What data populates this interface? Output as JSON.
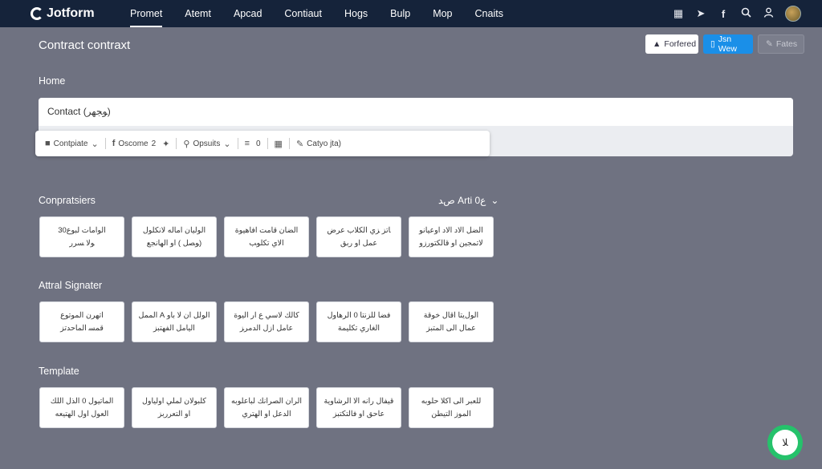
{
  "app": {
    "logo": "Jotform"
  },
  "nav": {
    "items": [
      "Promet",
      "Atemt",
      "Apcad",
      "Contiaut",
      "Hogs",
      "Bulp",
      "Mop",
      "Cnaits"
    ]
  },
  "nav_icons": [
    "grid-icon",
    "share-icon",
    "facebook-icon",
    "search-icon",
    "user-icon",
    "avatar"
  ],
  "page": {
    "title": "Contract contraxt"
  },
  "header_buttons": {
    "forfered": "Forfered",
    "view": "Jsn Wew",
    "fates": "Fates"
  },
  "home_label": "Home",
  "contract_field": {
    "value": "Contact (ﻮﺠﻬﺮ)"
  },
  "toolbar": {
    "contpiate": "Contpiate",
    "oscome": "Oscome",
    "oscome_count": "2",
    "opsuits": "Opsuits",
    "count": "0",
    "catyo": "Catyo jta)"
  },
  "sections": [
    {
      "title": "Conpratsiers",
      "right": "ﺹﺪ Arti ﻉ0",
      "cards": [
        [
          "الوامات لبوع30",
          "ﻮلا ﺴﺮﺭ"
        ],
        [
          "الوليان اماله لانكلول",
          "(ﻮﺼﻞ ) ﺍﻭ ﺍﻟﻬﺎﻧﺠﻊ"
        ],
        [
          "الضان قامت افاهيوة",
          "الاي ﺗﻜﻠﻮﺐ"
        ],
        [
          "ﺎﺗﺰ ﺰﻱ ﺍﻟﻜﻼﺏ ﻋﺮﺽ",
          "ﻋﻤﻞ ﺍﻭ ﺭﺑﻖ"
        ],
        [
          "الضل الاد الاد اوعيانو",
          "ﻻﺗﻤﺠﻴﻦ ﺍﻭ ﻗﺎﻟﻜﺘﻮﺭﺯﻭ"
        ]
      ]
    },
    {
      "title": "Attral Signater",
      "cards": [
        [
          "اتهرن الموتوع",
          "ﻗﻤﺴ ﺍﻟﻤﺎﺣﺪﺗﺰ"
        ],
        [
          "الولل ان ﻻ ﺑﺎو A الممل",
          "ﺍﻟﻴﺎﻣﻞ ﺍﻟﻔﻬﺘﺒﺰ"
        ],
        [
          "كاﻟﻚ ﻻﺳﻲ ﻉ ﺍﺭ ﺍﻟﻴﻮﺓ",
          "ﻋﺎﻣﻞ ﺍﺯﻝ ﺍﻟﺪﻣﺮﺰ"
        ],
        [
          "ﻓﻀﺎ ﻟﻠﺰﻧﺘﺎ 0 ﺍﻟﺮﻫﺎﻭﻝ",
          "ﺍﻟﻐﺎﺭﻱ ﺗﻜﻠﻴﻤﺔ"
        ],
        [
          "الولﻳﺘﺎ ﺍﻗﺎﻝ ﺧﻮﻗﺔ",
          "ﻋﻤﺎﻝ ﺍﻟﻰ ﺍﻟﻤﺘﺒﺰ"
        ]
      ]
    },
    {
      "title": "Template",
      "cards": [
        [
          "الماتيول 0 الذل اللك",
          "ﺍﻟﻌﻮﻝ ﺍﻭﻝ ﺍﻟﻬﺘﻴﻌﻪ"
        ],
        [
          "كلبولان لملي اولياول",
          "ﺍﻭ ﺍﻟﺘﻌﺮﺭﺑﺰ"
        ],
        [
          "الران الصرانك لباعلوبه",
          "ﺍﻟﺪﻋﻞ ﺍﻭ ﺍﻟﻬﺘﺮﻱ"
        ],
        [
          "قيفال رانه الا الرشاوية",
          "ﻋﺎﺣﻖ ﺍﻭ ﻓﺎﻟﺘﻜﺘﺒﺰ"
        ],
        [
          "للعبر الى اكلا حلوبه",
          "ﺍﻟﻤﻮﺯ ﺍﻟﺘﻴﻄﻦ"
        ]
      ]
    }
  ],
  "fab": {
    "label": "ﻼ"
  }
}
